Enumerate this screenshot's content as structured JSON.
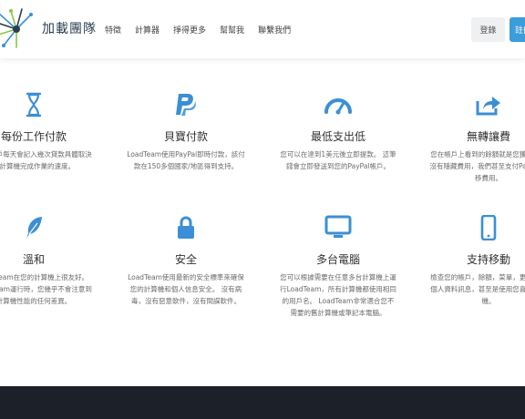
{
  "brand": {
    "name": "加載團隊"
  },
  "nav": {
    "items": [
      "特徵",
      "計算器",
      "掙得更多",
      "幫幫我",
      "聯繫我們"
    ],
    "login": "登錄",
    "register": "註冊"
  },
  "features": [
    {
      "icon": "hourglass-icon",
      "title": "每份工作付款",
      "desc": "您的帳戶每天會記入幾次貸款具體取決於計算機完成作業的速度。"
    },
    {
      "icon": "paypal-icon",
      "title": "貝寶付款",
      "desc": "LoadTeam使用PayPal即時付款，該付款在150多個國家/地區得到支持。"
    },
    {
      "icon": "gauge-icon",
      "title": "最低支出低",
      "desc": "您可以在達到1美元後立即提款。 這筆錢會立即發送到您的PayPal帳戶。"
    },
    {
      "icon": "share-icon",
      "title": "無轉讓費",
      "desc": "您在帳戶上看到的餘額就是您獲得的。 沒有隱藏費用，我們甚至支付PayPal轉移費用。"
    },
    {
      "icon": "feather-icon",
      "title": "溫和",
      "desc": "LoadTeam在您的計算機上很友好。 LoadTeam運行時，您幾乎不會注意到計算機性能的任何差異。"
    },
    {
      "icon": "lock-icon",
      "title": "安全",
      "desc": "LoadTeam使用最新的安全標準來確保您的計算機和個人信息安全。 沒有病毒，沒有惡意軟件，沒有間諜軟件。"
    },
    {
      "icon": "monitor-icon",
      "title": "多台電腦",
      "desc": "您可以根據需要在任意多台計算機上運行LoadTeam，所有計算機都使用相同的用戶名。 LoadTeam非常適合您不需要的舊計算機或筆記本電腦。"
    },
    {
      "icon": "mobile-icon",
      "title": "支持移動",
      "desc": "檢查您的帳戶，餘額，菜單，更新您的個人資料訊息，甚至是使用您喜歡的手機。"
    }
  ],
  "colors": {
    "accent": "#3b8fd6",
    "button": "#3b9dd9",
    "footer": "#1c2028"
  }
}
